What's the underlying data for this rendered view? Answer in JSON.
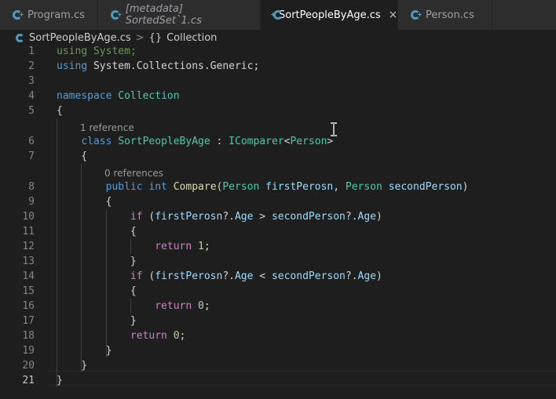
{
  "tabs": [
    {
      "label": "Program.cs",
      "italic": false,
      "active": false
    },
    {
      "label": "[metadata] SortedSet`1.cs",
      "italic": true,
      "active": false
    },
    {
      "label": "SortPeopleByAge.cs",
      "italic": false,
      "active": true,
      "close": "×"
    },
    {
      "label": "Person.cs",
      "italic": false,
      "active": false
    }
  ],
  "breadcrumb": {
    "file": "SortPeopleByAge.cs",
    "separator": ">",
    "symbol_icon": "{}",
    "symbol": "Collection"
  },
  "codelens": {
    "class_refs": "1 reference",
    "method_refs": "0 references"
  },
  "line_numbers": [
    "1",
    "2",
    "3",
    "4",
    "5",
    "6",
    "7",
    "8",
    "9",
    "10",
    "11",
    "12",
    "13",
    "14",
    "15",
    "16",
    "17",
    "18",
    "19",
    "20",
    "21"
  ],
  "lines": [
    {
      "n": 1,
      "tokens": [
        {
          "t": "using",
          "c": "dim"
        },
        {
          "t": " "
        },
        {
          "t": "System",
          "c": "dim"
        },
        {
          "t": ";",
          "c": "dim"
        }
      ]
    },
    {
      "n": 2,
      "tokens": [
        {
          "t": "using",
          "c": "kw"
        },
        {
          "t": " System.Collections.Generic;"
        }
      ]
    },
    {
      "n": 3,
      "tokens": []
    },
    {
      "n": 4,
      "tokens": [
        {
          "t": "namespace",
          "c": "kw"
        },
        {
          "t": " "
        },
        {
          "t": "Collection",
          "c": "ty"
        }
      ]
    },
    {
      "n": 5,
      "tokens": [
        {
          "t": "{"
        }
      ]
    },
    {
      "n": 6,
      "tokens": [
        {
          "t": "    "
        },
        {
          "t": "class",
          "c": "kw"
        },
        {
          "t": " "
        },
        {
          "t": "SortPeopleByAge",
          "c": "ty"
        },
        {
          "t": " : "
        },
        {
          "t": "IComparer",
          "c": "ty"
        },
        {
          "t": "<"
        },
        {
          "t": "Person",
          "c": "ty"
        },
        {
          "t": ">"
        }
      ]
    },
    {
      "n": 7,
      "tokens": [
        {
          "t": "    {"
        }
      ]
    },
    {
      "n": 8,
      "tokens": [
        {
          "t": "        "
        },
        {
          "t": "public",
          "c": "kw"
        },
        {
          "t": " "
        },
        {
          "t": "int",
          "c": "kw"
        },
        {
          "t": " "
        },
        {
          "t": "Compare",
          "c": "fn"
        },
        {
          "t": "("
        },
        {
          "t": "Person",
          "c": "ty"
        },
        {
          "t": " "
        },
        {
          "t": "firstPerosn",
          "c": "pr"
        },
        {
          "t": ", "
        },
        {
          "t": "Person",
          "c": "ty"
        },
        {
          "t": " "
        },
        {
          "t": "secondPerson",
          "c": "pr"
        },
        {
          "t": ")"
        }
      ]
    },
    {
      "n": 9,
      "tokens": [
        {
          "t": "        {"
        }
      ]
    },
    {
      "n": 10,
      "tokens": [
        {
          "t": "            "
        },
        {
          "t": "if",
          "c": "ctl"
        },
        {
          "t": " ("
        },
        {
          "t": "firstPerosn",
          "c": "pr"
        },
        {
          "t": "?."
        },
        {
          "t": "Age",
          "c": "pr"
        },
        {
          "t": " > "
        },
        {
          "t": "secondPerson",
          "c": "pr"
        },
        {
          "t": "?."
        },
        {
          "t": "Age",
          "c": "pr"
        },
        {
          "t": ")"
        }
      ]
    },
    {
      "n": 11,
      "tokens": [
        {
          "t": "            {"
        }
      ]
    },
    {
      "n": 12,
      "tokens": [
        {
          "t": "                "
        },
        {
          "t": "return",
          "c": "ctl"
        },
        {
          "t": " "
        },
        {
          "t": "1",
          "c": "nu"
        },
        {
          "t": ";"
        }
      ]
    },
    {
      "n": 13,
      "tokens": [
        {
          "t": "            }"
        }
      ]
    },
    {
      "n": 14,
      "tokens": [
        {
          "t": "            "
        },
        {
          "t": "if",
          "c": "ctl"
        },
        {
          "t": " ("
        },
        {
          "t": "firstPerosn",
          "c": "pr"
        },
        {
          "t": "?."
        },
        {
          "t": "Age",
          "c": "pr"
        },
        {
          "t": " < "
        },
        {
          "t": "secondPerson",
          "c": "pr"
        },
        {
          "t": "?."
        },
        {
          "t": "Age",
          "c": "pr"
        },
        {
          "t": ")"
        }
      ]
    },
    {
      "n": 15,
      "tokens": [
        {
          "t": "            {"
        }
      ]
    },
    {
      "n": 16,
      "tokens": [
        {
          "t": "                "
        },
        {
          "t": "return",
          "c": "ctl"
        },
        {
          "t": " "
        },
        {
          "t": "0",
          "c": "nu"
        },
        {
          "t": ";"
        }
      ]
    },
    {
      "n": 17,
      "tokens": [
        {
          "t": "            }"
        }
      ]
    },
    {
      "n": 18,
      "tokens": [
        {
          "t": "            "
        },
        {
          "t": "return",
          "c": "ctl"
        },
        {
          "t": " "
        },
        {
          "t": "0",
          "c": "nu"
        },
        {
          "t": ";"
        }
      ]
    },
    {
      "n": 19,
      "tokens": [
        {
          "t": "        }"
        }
      ]
    },
    {
      "n": 20,
      "tokens": [
        {
          "t": "    }"
        }
      ]
    },
    {
      "n": 21,
      "tokens": [
        {
          "t": "}"
        }
      ]
    }
  ],
  "colors": {
    "editor_bg": "#1e1e1e",
    "tabbar_bg": "#2d2d2d",
    "keyword": "#569cd6",
    "control": "#c586c0",
    "type": "#4ec9b0",
    "function": "#dcdcaa",
    "parameter": "#9cdcfe",
    "number": "#b5cea8",
    "csharp_icon": "#519aba"
  },
  "icons": {
    "tab_file": "csharp-file-icon",
    "close": "close-icon",
    "cursor": "text-ibeam-cursor-icon"
  }
}
